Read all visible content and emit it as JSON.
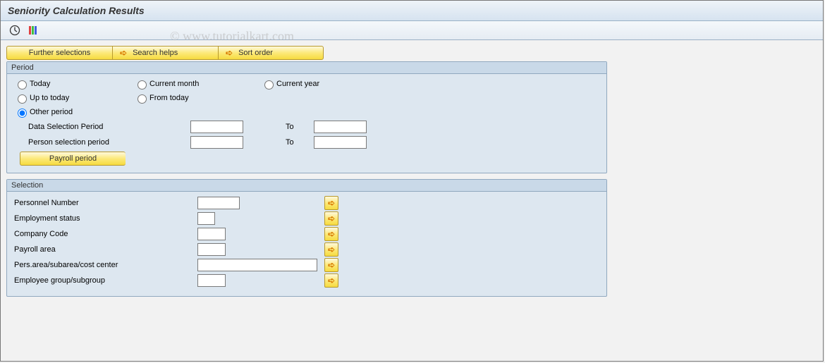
{
  "header": {
    "title": "Seniority Calculation Results"
  },
  "watermark": "© www.tutorialkart.com",
  "toolbar_buttons": {
    "further_selections": "Further selections",
    "search_helps": "Search helps",
    "sort_order": "Sort order"
  },
  "period": {
    "title": "Period",
    "today": "Today",
    "current_month": "Current month",
    "current_year": "Current year",
    "up_to_today": "Up to today",
    "from_today": "From today",
    "other_period": "Other period",
    "data_sel_period": "Data Selection Period",
    "person_sel_period": "Person selection period",
    "to": "To",
    "payroll_period": "Payroll period",
    "values": {
      "data_from": "",
      "data_to": "",
      "person_from": "",
      "person_to": ""
    }
  },
  "selection": {
    "title": "Selection",
    "rows": {
      "personnel_number": {
        "label": "Personnel Number",
        "value": ""
      },
      "employment_status": {
        "label": "Employment status",
        "value": ""
      },
      "company_code": {
        "label": "Company Code",
        "value": ""
      },
      "payroll_area": {
        "label": "Payroll area",
        "value": ""
      },
      "pers_area": {
        "label": "Pers.area/subarea/cost center",
        "value": ""
      },
      "employee_group": {
        "label": "Employee group/subgroup",
        "value": ""
      }
    }
  }
}
